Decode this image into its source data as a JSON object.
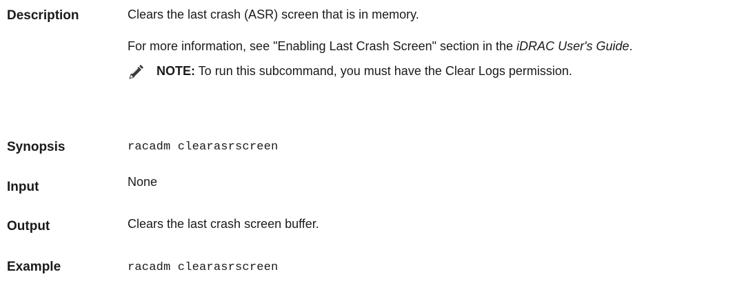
{
  "rows": {
    "description": {
      "label": "Description",
      "line1": "Clears the last crash (ASR) screen that is in memory.",
      "more_info_prefix": "For more information, see \"Enabling Last Crash Screen\" section in the ",
      "more_info_guide": "iDRAC User's Guide",
      "more_info_suffix": ".",
      "note_label": "NOTE:",
      "note_text": " To run this subcommand, you must have the Clear Logs permission."
    },
    "synopsis": {
      "label": "Synopsis",
      "code": "racadm clearasrscreen"
    },
    "input": {
      "label": "Input",
      "text": "None"
    },
    "output": {
      "label": "Output",
      "text": "Clears the last crash screen buffer."
    },
    "example": {
      "label": "Example",
      "code": "racadm clearasrscreen"
    }
  },
  "icons": {
    "note": "pencil-note-icon"
  }
}
